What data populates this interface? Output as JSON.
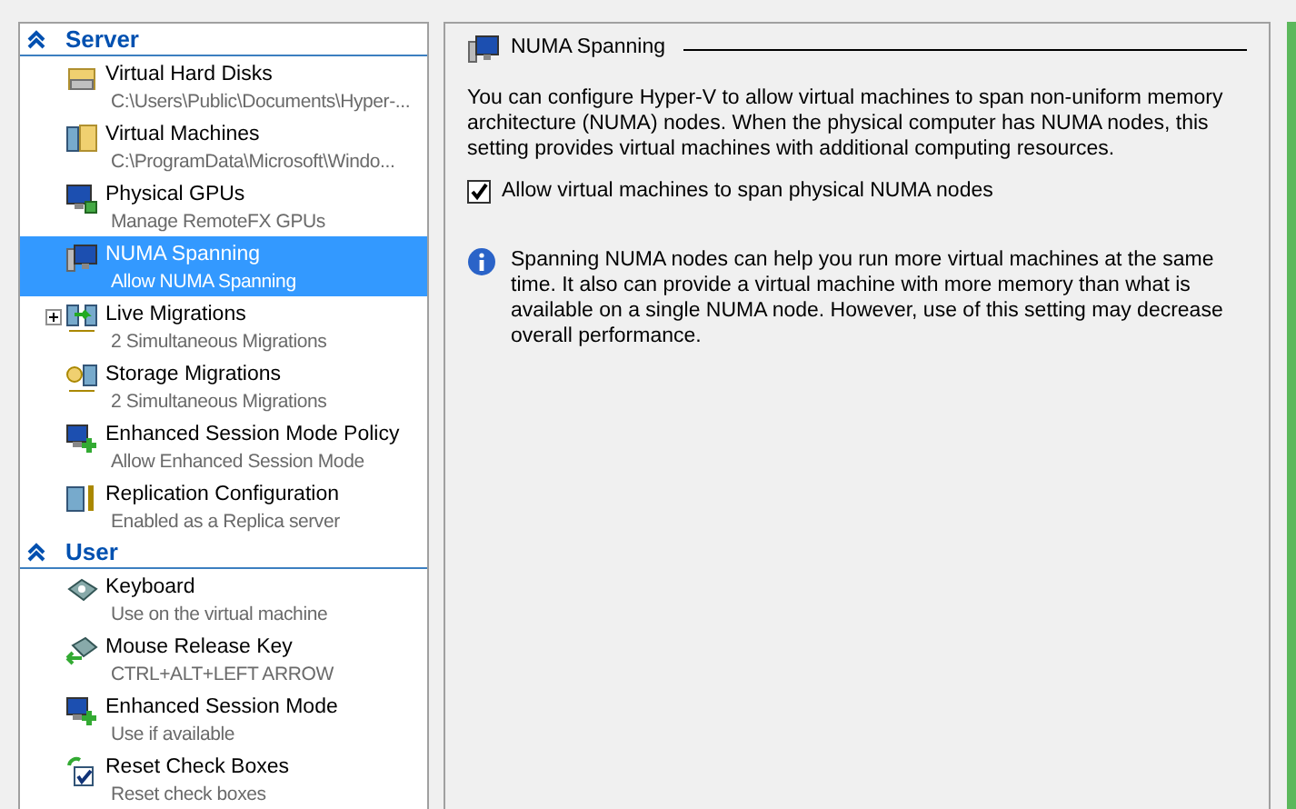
{
  "sidebar": {
    "sections": [
      {
        "title": "Server",
        "expanded": true,
        "items": [
          {
            "title": "Virtual Hard Disks",
            "subtitle": "C:\\Users\\Public\\Documents\\Hyper-...",
            "selected": false
          },
          {
            "title": "Virtual Machines",
            "subtitle": "C:\\ProgramData\\Microsoft\\Windo...",
            "selected": false
          },
          {
            "title": "Physical GPUs",
            "subtitle": "Manage RemoteFX GPUs",
            "selected": false
          },
          {
            "title": "NUMA Spanning",
            "subtitle": "Allow NUMA Spanning",
            "selected": true
          },
          {
            "title": "Live Migrations",
            "subtitle": "2 Simultaneous Migrations",
            "selected": false,
            "expanded": false
          },
          {
            "title": "Storage Migrations",
            "subtitle": "2 Simultaneous Migrations",
            "selected": false
          },
          {
            "title": "Enhanced Session Mode Policy",
            "subtitle": "Allow Enhanced Session Mode",
            "selected": false
          },
          {
            "title": "Replication Configuration",
            "subtitle": "Enabled as a Replica server",
            "selected": false
          }
        ]
      },
      {
        "title": "User",
        "expanded": true,
        "items": [
          {
            "title": "Keyboard",
            "subtitle": "Use on the virtual machine",
            "selected": false
          },
          {
            "title": "Mouse Release Key",
            "subtitle": "CTRL+ALT+LEFT ARROW",
            "selected": false
          },
          {
            "title": "Enhanced Session Mode",
            "subtitle": "Use if available",
            "selected": false
          },
          {
            "title": "Reset Check Boxes",
            "subtitle": "Reset check boxes",
            "selected": false
          }
        ]
      }
    ]
  },
  "panel": {
    "title": "NUMA Spanning",
    "description": "You can configure Hyper-V to allow virtual machines to span non-uniform memory architecture (NUMA) nodes. When the physical computer has NUMA nodes, this setting provides virtual machines with additional computing resources.",
    "checkbox": {
      "label": "Allow virtual machines to span physical NUMA nodes",
      "checked": true
    },
    "info": "Spanning NUMA nodes can help you run more virtual machines at the same time. It also can provide a virtual machine with more memory than what is available on a single NUMA node. However, use of this setting may decrease overall performance."
  }
}
